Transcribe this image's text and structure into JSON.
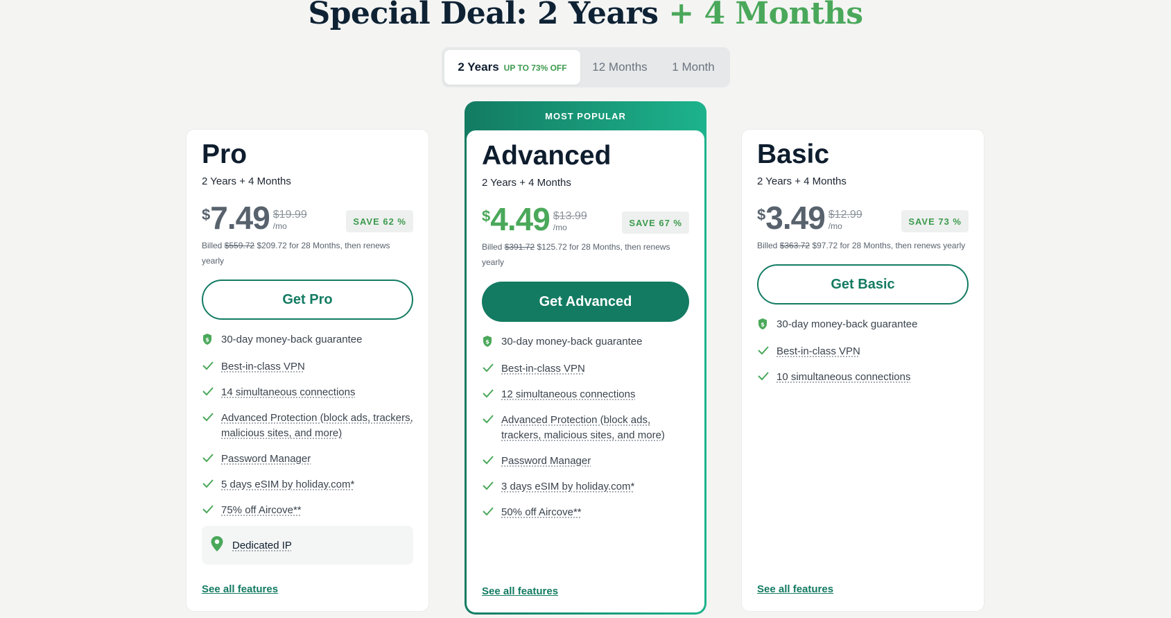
{
  "headline": {
    "main": "Special Deal: 2 Years",
    "accent": "+ 4 Months"
  },
  "tabs": [
    {
      "label": "2 Years",
      "badge": "UP TO 73% OFF"
    },
    {
      "label": "12 Months"
    },
    {
      "label": "1 Month"
    }
  ],
  "colors": {
    "accent": "#137b62",
    "green": "#4aa85a"
  },
  "plans": {
    "pro": {
      "name": "Pro",
      "term": "2 Years + 4 Months",
      "currency": "$",
      "price": "7.49",
      "old_price": "$19.99",
      "per": "/mo",
      "save": "SAVE 62 %",
      "billed_prefix": "Billed",
      "billed_old": "$559.72",
      "billed_rest": "$209.72 for 28 Months, then renews yearly",
      "cta": "Get Pro",
      "guarantee": "30-day money-back guarantee",
      "features": [
        "Best-in-class VPN",
        "14 simultaneous connections",
        "Advanced Protection (block ads, trackers, malicious sites, and more)",
        "Password Manager",
        "5 days eSIM by holiday.com*",
        "75% off Aircove**"
      ],
      "dedicated_ip": "Dedicated IP",
      "see_all": "See all features"
    },
    "advanced": {
      "popular_label": "MOST POPULAR",
      "name": "Advanced",
      "term": "2 Years + 4 Months",
      "currency": "$",
      "price": "4.49",
      "old_price": "$13.99",
      "per": "/mo",
      "save": "SAVE 67 %",
      "billed_prefix": "Billed",
      "billed_old": "$391.72",
      "billed_rest": "$125.72 for 28 Months, then renews yearly",
      "cta": "Get Advanced",
      "guarantee": "30-day money-back guarantee",
      "features": [
        "Best-in-class VPN",
        "12 simultaneous connections",
        "Advanced Protection (block ads, trackers, malicious sites, and more)",
        "Password Manager",
        "3 days eSIM by holiday.com*",
        "50% off Aircove**"
      ],
      "see_all": "See all features"
    },
    "basic": {
      "name": "Basic",
      "term": "2 Years + 4 Months",
      "currency": "$",
      "price": "3.49",
      "old_price": "$12.99",
      "per": "/mo",
      "save": "SAVE 73 %",
      "billed_prefix": "Billed",
      "billed_old": "$363.72",
      "billed_rest": "$97.72 for 28 Months, then renews yearly",
      "cta": "Get Basic",
      "guarantee": "30-day money-back guarantee",
      "features": [
        "Best-in-class VPN",
        "10 simultaneous connections"
      ],
      "see_all": "See all features"
    }
  }
}
